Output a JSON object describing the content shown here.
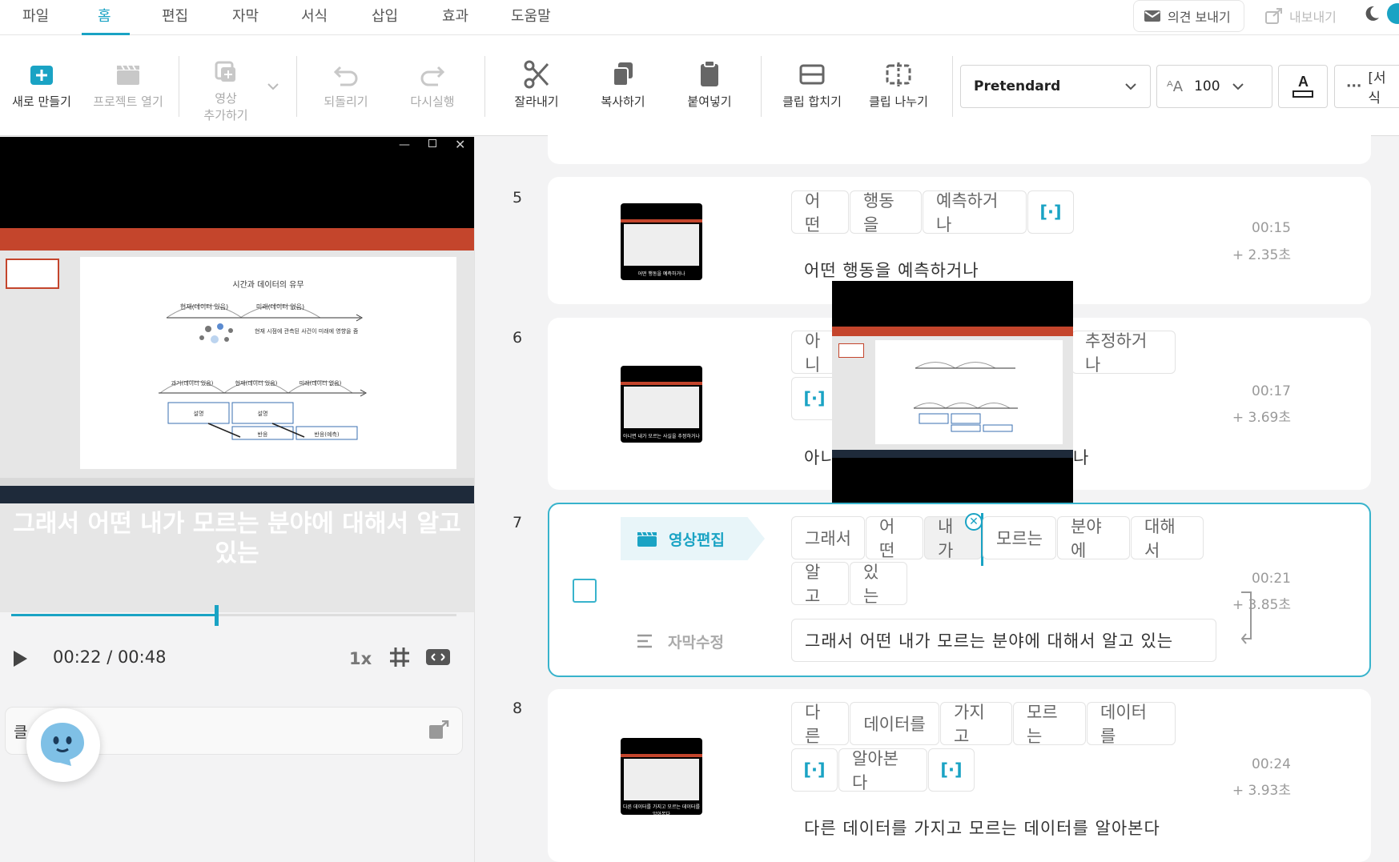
{
  "menu": {
    "items": [
      "파일",
      "홈",
      "편집",
      "자막",
      "서식",
      "삽입",
      "효과",
      "도움말"
    ],
    "feedback": "의견 보내기",
    "export": "내보내기"
  },
  "toolbar": {
    "new": "새로 만들기",
    "open": "프로젝트 열기",
    "add_video_1": "영상",
    "add_video_2": "추가하기",
    "undo": "되돌리기",
    "redo": "다시실행",
    "cut": "잘라내기",
    "copy": "복사하기",
    "paste": "붙여넣기",
    "merge": "클립 합치기",
    "split": "클립 나누기",
    "font": "Pretendard",
    "font_size": "100",
    "more": "[서식"
  },
  "player": {
    "caption": "그래서 어떤 내가 모르는 분야에 대해서 알고 있는",
    "time": "00:22 / 00:48",
    "speed": "1x",
    "progress": 0.46,
    "slide": {
      "title": "시간과 데이터의 유무",
      "arc_past": "현재(데이터 있음)",
      "arc_future": "미래(데이터 없음)",
      "note": "현재 시점에 관측된 사건이 미래에 영향을 줌",
      "arc2_past": "과거(데이터 있음)",
      "arc2_now": "현재(데이터 있음)",
      "arc2_future": "미래(데이터 없음)",
      "box1": "설명",
      "box2": "설명",
      "box3": "반응",
      "box4": "반응(예측)"
    },
    "input_prefix": "클"
  },
  "rows": [
    {
      "num": "5",
      "chips": [
        "어떤",
        "행동을",
        "예측하거나",
        "[·]"
      ],
      "text": "어떤 행동을 예측하거나",
      "time": "00:15",
      "dur": "+ 2.35초"
    },
    {
      "num": "6",
      "chips": [
        "아니",
        "추정하거나",
        "[·]"
      ],
      "text_left": "아니",
      "text_right": "나",
      "time": "00:17",
      "dur": "+ 3.69초"
    },
    {
      "num": "7",
      "tag": "영상편집",
      "edit_label": "자막수정",
      "chips": [
        "그래서",
        "어떤",
        "내가",
        "모르는",
        "분야에",
        "대해서",
        "알고",
        "있는"
      ],
      "text": "그래서 어떤 내가 모르는 분야에 대해서 알고 있는",
      "time": "00:21",
      "dur": "+ 3.85초"
    },
    {
      "num": "8",
      "chips": [
        "다른",
        "데이터를",
        "가지고",
        "모르는",
        "데이터를",
        "[·]",
        "알아본다",
        "[·]"
      ],
      "text": "다른 데이터를 가지고 모르는 데이터를 알아본다",
      "time": "00:24",
      "dur": "+ 3.93초"
    }
  ],
  "thumb_captions": [
    "어떤 행동을 예측하거나",
    "아니면 내가 모르는 사실을 추정하거나",
    "다른 데이터를 가지고 모르는 데이터를 알아본다"
  ],
  "colors": {
    "accent": "#1aa3c4",
    "ppt": "#c4452c"
  }
}
